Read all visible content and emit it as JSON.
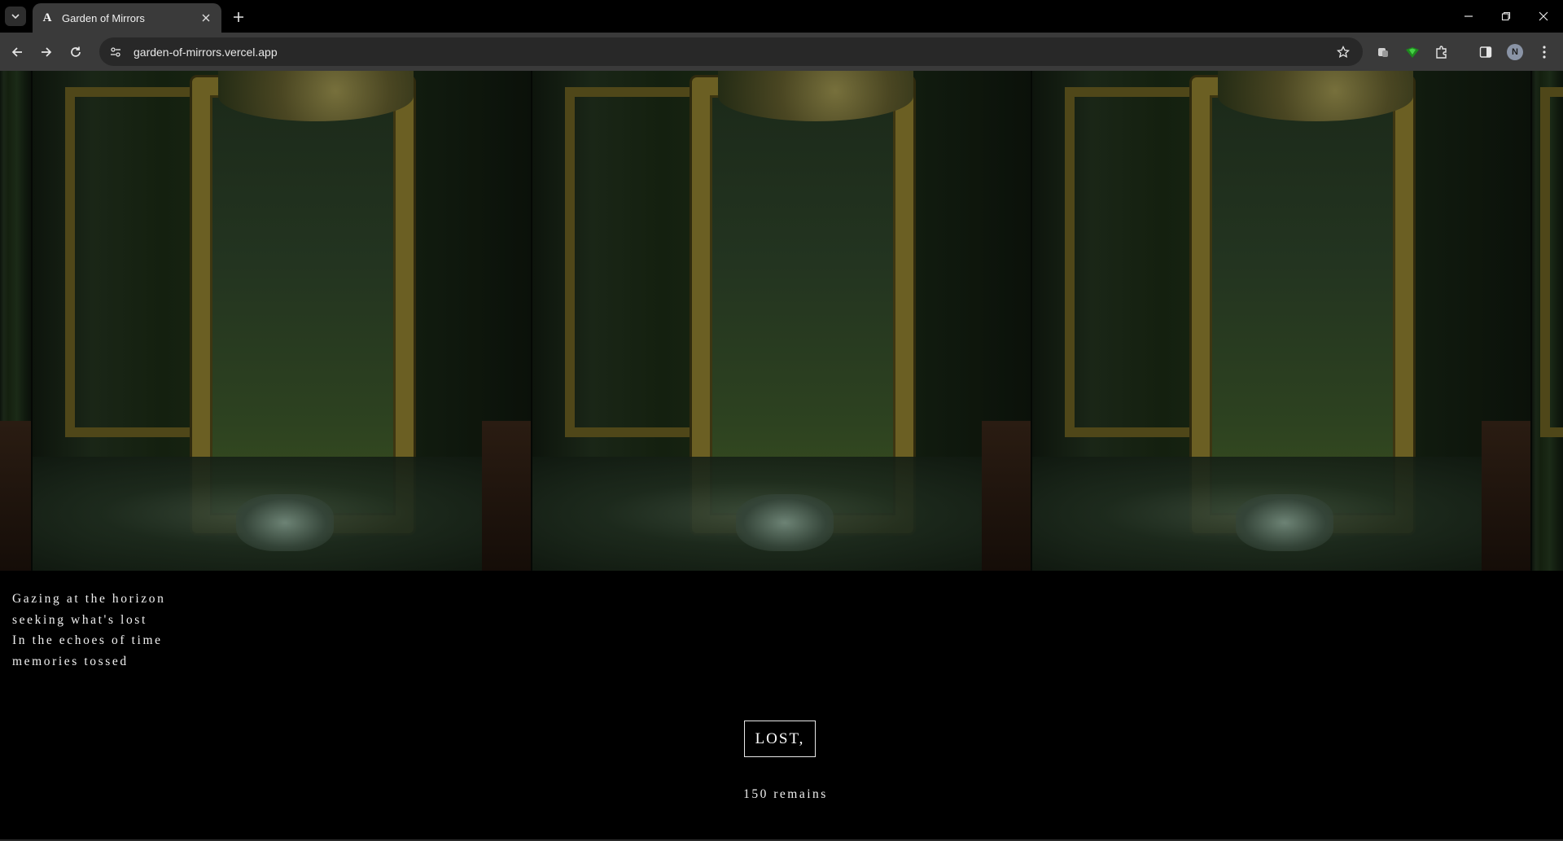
{
  "browser": {
    "tab": {
      "title": "Garden of Mirrors",
      "favicon": "A"
    },
    "url": "garden-of-mirrors.vercel.app",
    "profile_initial": "N"
  },
  "page": {
    "poem_lines": [
      "Gazing at the horizon",
      "seeking what's lost",
      "In the echoes of time",
      "memories tossed"
    ],
    "button_label": "LOST,",
    "remains_text": "150 remains"
  }
}
